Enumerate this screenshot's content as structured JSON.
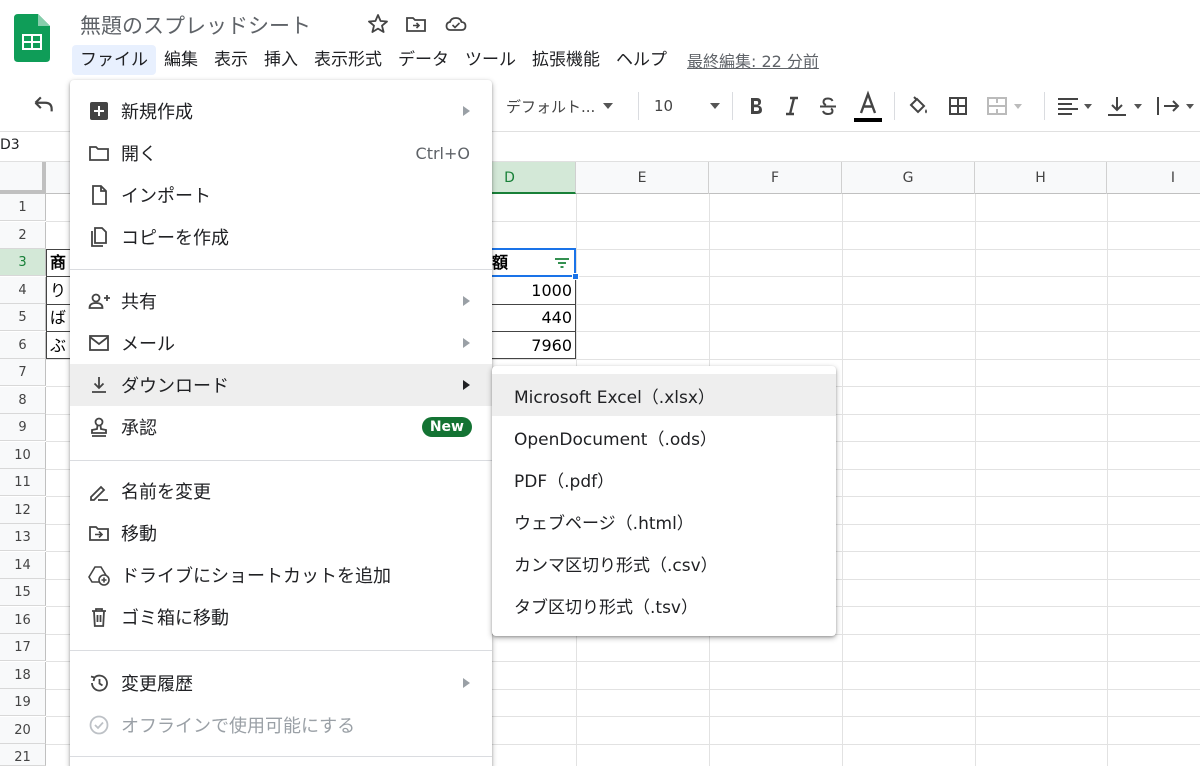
{
  "header": {
    "title": "無題のスプレッドシート",
    "last_edit": "最終編集: 22 分前",
    "menu": [
      "ファイル",
      "編集",
      "表示",
      "挿入",
      "表示形式",
      "データ",
      "ツール",
      "拡張機能",
      "ヘルプ"
    ]
  },
  "toolbar": {
    "font": "デフォルト...",
    "font_size": "10"
  },
  "formula_bar": {
    "name_box": "D3"
  },
  "grid": {
    "columns": [
      "D",
      "E",
      "F",
      "G",
      "H",
      "I"
    ],
    "rows": [
      "1",
      "2",
      "3",
      "4",
      "5",
      "6",
      "7",
      "8",
      "9",
      "10",
      "11",
      "12",
      "13",
      "14",
      "15",
      "16",
      "17",
      "18",
      "19",
      "20",
      "21"
    ],
    "col_a_fragments": [
      "商",
      "り",
      "ば",
      "ぶ"
    ],
    "d_header_fragment": "額",
    "d_values": [
      "1000",
      "440",
      "7960"
    ]
  },
  "file_menu": {
    "items": [
      {
        "label": "新規作成",
        "icon": "new-sheet-icon",
        "submenu": true
      },
      {
        "label": "開く",
        "icon": "folder-icon",
        "shortcut": "Ctrl+O"
      },
      {
        "label": "インポート",
        "icon": "file-icon"
      },
      {
        "label": "コピーを作成",
        "icon": "copy-icon"
      },
      {
        "label": "共有",
        "icon": "person-add-icon",
        "submenu": true
      },
      {
        "label": "メール",
        "icon": "mail-icon",
        "submenu": true
      },
      {
        "label": "ダウンロード",
        "icon": "download-icon",
        "submenu": true
      },
      {
        "label": "承認",
        "icon": "stamp-icon",
        "badge": "New"
      },
      {
        "label": "名前を変更",
        "icon": "rename-icon"
      },
      {
        "label": "移動",
        "icon": "move-icon"
      },
      {
        "label": "ドライブにショートカットを追加",
        "icon": "drive-shortcut-icon"
      },
      {
        "label": "ゴミ箱に移動",
        "icon": "trash-icon"
      },
      {
        "label": "変更履歴",
        "icon": "history-icon",
        "submenu": true
      },
      {
        "label": "オフラインで使用可能にする",
        "icon": "offline-icon",
        "disabled": true
      }
    ]
  },
  "download_submenu": {
    "items": [
      "Microsoft Excel（.xlsx）",
      "OpenDocument（.ods）",
      "PDF（.pdf）",
      "ウェブページ（.html）",
      "カンマ区切り形式（.csv）",
      "タブ区切り形式（.tsv）"
    ]
  },
  "colors": {
    "brand_green": "#0f9d58",
    "selection_green": "#188038",
    "badge_green": "#137333",
    "filter_green": "#188038"
  }
}
